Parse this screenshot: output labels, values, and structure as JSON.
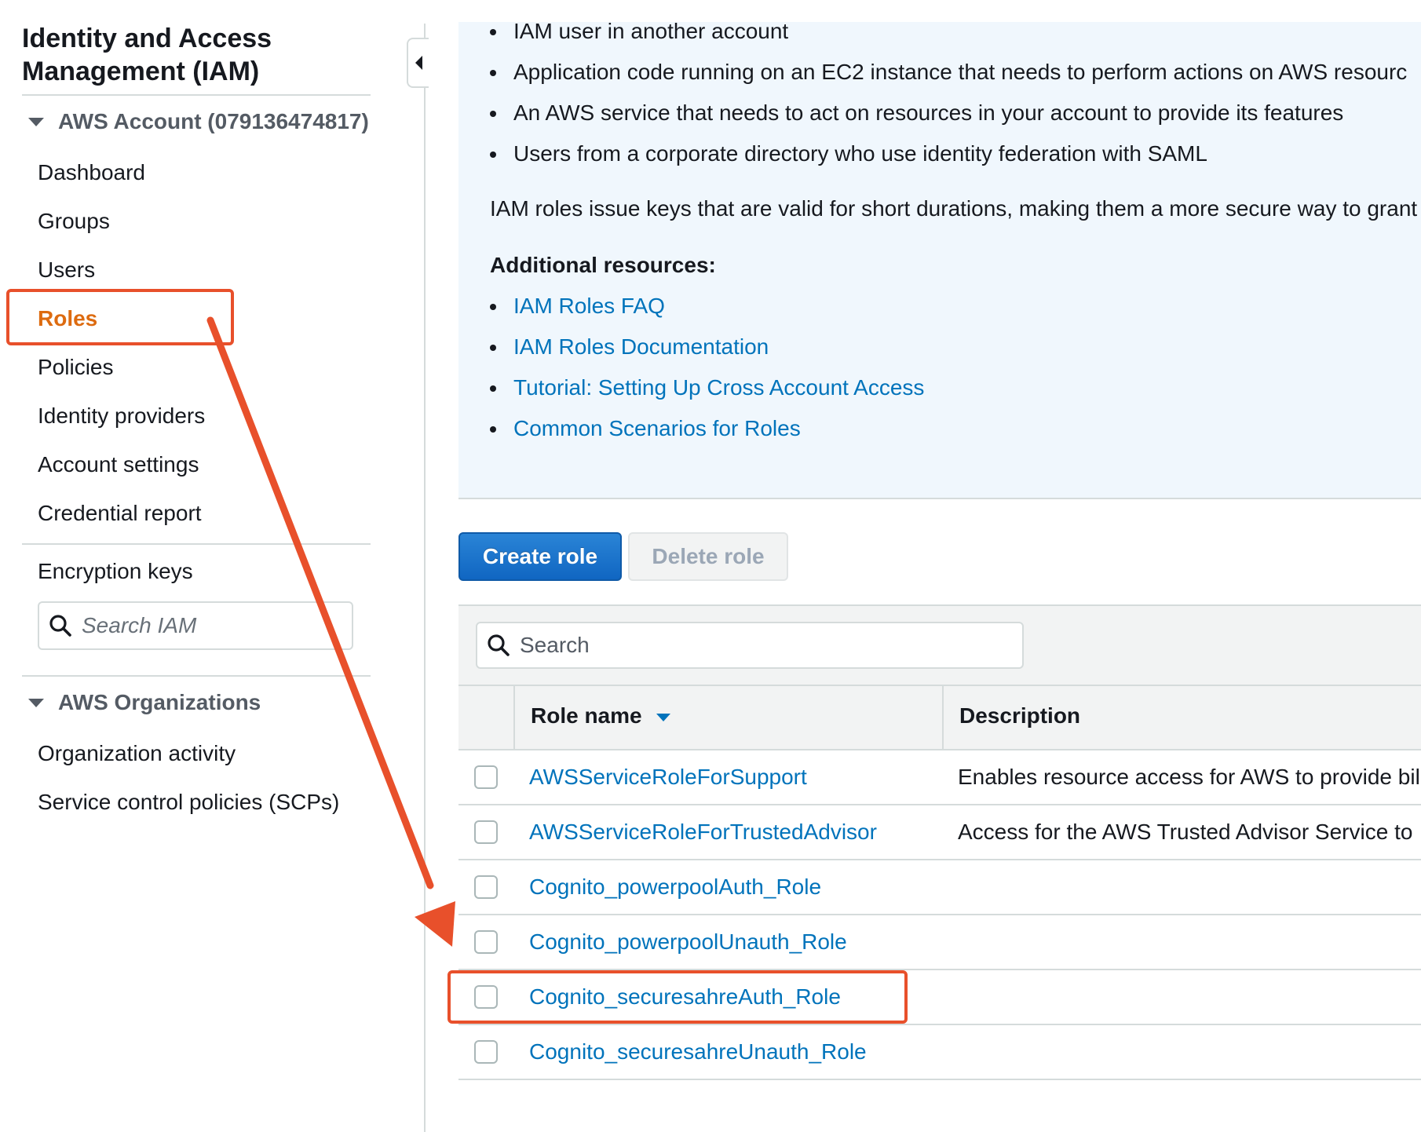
{
  "sidebar": {
    "title_line1": "Identity and Access",
    "title_line2": "Management (IAM)",
    "account_section": "AWS Account (079136474817)",
    "items": [
      {
        "label": "Dashboard"
      },
      {
        "label": "Groups"
      },
      {
        "label": "Users"
      },
      {
        "label": "Roles"
      },
      {
        "label": "Policies"
      },
      {
        "label": "Identity providers"
      },
      {
        "label": "Account settings"
      },
      {
        "label": "Credential report"
      }
    ],
    "encryption_keys": "Encryption keys",
    "search_placeholder": "Search IAM",
    "org_section": "AWS Organizations",
    "org_items": [
      {
        "label": "Organization activity"
      },
      {
        "label": "Service control policies (SCPs)"
      }
    ]
  },
  "info": {
    "bullets": [
      "IAM user in another account",
      "Application code running on an EC2 instance that needs to perform actions on AWS resourc",
      "An AWS service that needs to act on resources in your account to provide its features",
      "Users from a corporate directory who use identity federation with SAML"
    ],
    "paragraph": "IAM roles issue keys that are valid for short durations, making them a more secure way to grant",
    "resources_heading": "Additional resources:",
    "links": [
      "IAM Roles FAQ",
      "IAM Roles Documentation",
      "Tutorial: Setting Up Cross Account Access",
      "Common Scenarios for Roles"
    ]
  },
  "actions": {
    "create_label": "Create role",
    "delete_label": "Delete role"
  },
  "table": {
    "search_placeholder": "Search",
    "columns": {
      "role_name": "Role name",
      "description": "Description"
    },
    "rows": [
      {
        "name": "AWSServiceRoleForSupport",
        "description": "Enables resource access for AWS to provide bil"
      },
      {
        "name": "AWSServiceRoleForTrustedAdvisor",
        "description": "Access for the AWS Trusted Advisor Service to"
      },
      {
        "name": "Cognito_powerpoolAuth_Role",
        "description": ""
      },
      {
        "name": "Cognito_powerpoolUnauth_Role",
        "description": ""
      },
      {
        "name": "Cognito_securesahreAuth_Role",
        "description": ""
      },
      {
        "name": "Cognito_securesahreUnauth_Role",
        "description": ""
      }
    ]
  },
  "colors": {
    "accent_orange": "#dd6b10",
    "link_blue": "#0073bb",
    "annotation_red": "#e8502b",
    "primary_button": "#1066c2"
  }
}
